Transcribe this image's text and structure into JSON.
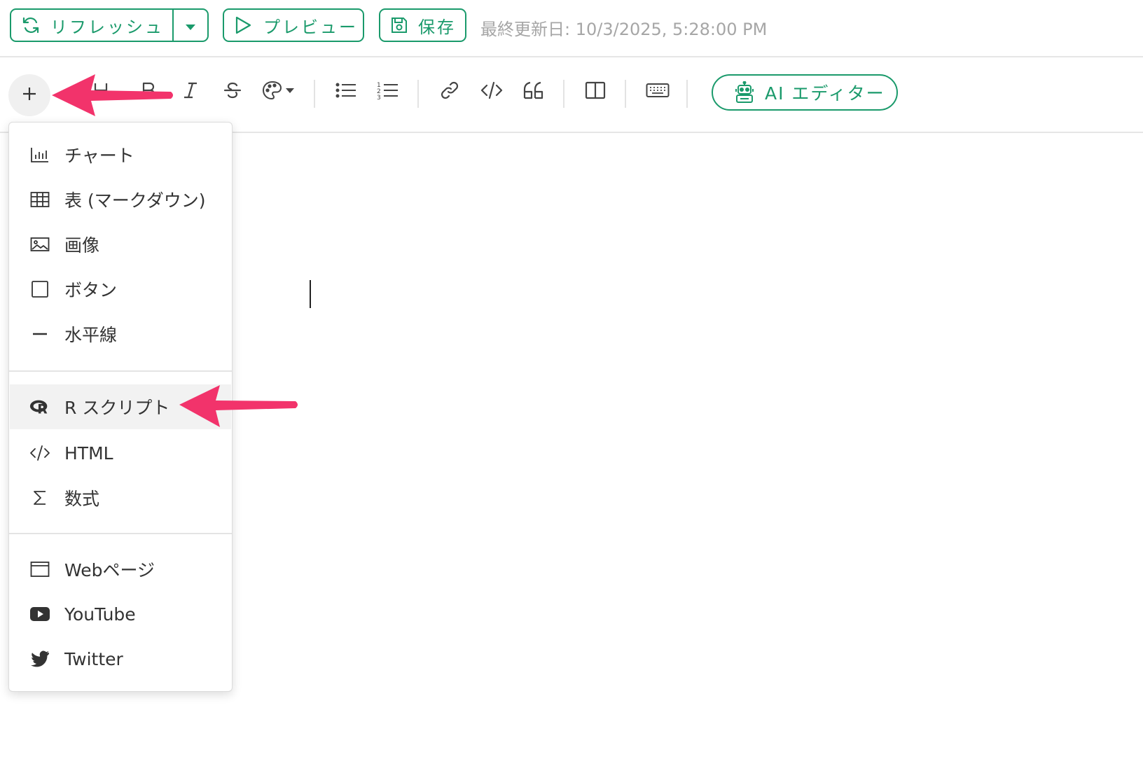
{
  "topbar": {
    "refresh_label": "リフレッシュ",
    "preview_label": "プレビュー",
    "save_label": "保存",
    "last_updated": "最終更新日: 10/3/2025, 5:28:00 PM"
  },
  "toolbar": {
    "tools": [
      {
        "name": "insert",
        "icon": "plus-icon"
      },
      {
        "name": "heading",
        "icon": "heading-icon"
      },
      {
        "name": "bold",
        "icon": "bold-icon"
      },
      {
        "name": "italic",
        "icon": "italic-icon"
      },
      {
        "name": "strikethrough",
        "icon": "strikethrough-icon"
      },
      {
        "name": "color",
        "icon": "palette-icon"
      },
      {
        "name": "bullet-list",
        "icon": "bullet-list-icon"
      },
      {
        "name": "numbered-list",
        "icon": "numbered-list-icon"
      },
      {
        "name": "link",
        "icon": "link-icon"
      },
      {
        "name": "code",
        "icon": "code-icon"
      },
      {
        "name": "quote",
        "icon": "quote-icon"
      },
      {
        "name": "columns",
        "icon": "columns-icon"
      },
      {
        "name": "keyboard",
        "icon": "keyboard-icon"
      }
    ],
    "ai_editor_label": "AI エディター"
  },
  "menu": {
    "items": [
      {
        "label": "チャート",
        "icon": "chart-icon"
      },
      {
        "label": "表 (マークダウン)",
        "icon": "table-icon"
      },
      {
        "label": "画像",
        "icon": "image-icon"
      },
      {
        "label": "ボタン",
        "icon": "button-icon"
      },
      {
        "label": "水平線",
        "icon": "horizontal-rule-icon"
      },
      {
        "label": "R スクリプト",
        "icon": "r-logo-icon",
        "highlighted": true
      },
      {
        "label": "HTML",
        "icon": "code-icon"
      },
      {
        "label": "数式",
        "icon": "sigma-icon"
      },
      {
        "label": "Webページ",
        "icon": "browser-window-icon"
      },
      {
        "label": "YouTube",
        "icon": "youtube-icon"
      },
      {
        "label": "Twitter",
        "icon": "twitter-icon"
      }
    ]
  },
  "colors": {
    "accent": "#1a9a6b",
    "annotation_arrow": "#f2336b",
    "muted_text": "#a6a6a6"
  }
}
